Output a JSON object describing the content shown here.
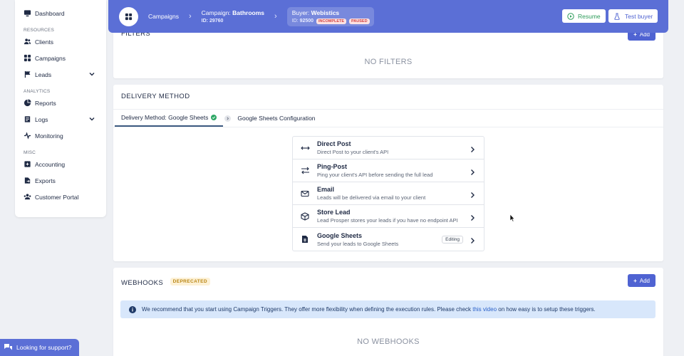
{
  "sidebar": {
    "items_top": [
      {
        "label": "Dashboard",
        "icon": "monitor-icon"
      }
    ],
    "sections": [
      {
        "title": "RESOURCES",
        "items": [
          {
            "label": "Clients",
            "icon": "users-icon"
          },
          {
            "label": "Campaigns",
            "icon": "grid-icon"
          },
          {
            "label": "Leads",
            "icon": "flag-icon"
          }
        ]
      },
      {
        "title": "ANALYTICS",
        "items": [
          {
            "label": "Reports",
            "icon": "pie-chart-icon"
          },
          {
            "label": "Logs",
            "icon": "log-icon"
          },
          {
            "label": "Monitoring",
            "icon": "heartbeat-icon"
          }
        ]
      },
      {
        "title": "MISC",
        "items": [
          {
            "label": "Accounting",
            "icon": "accounting-icon"
          },
          {
            "label": "Exports",
            "icon": "export-icon"
          },
          {
            "label": "Customer Portal",
            "icon": "portal-icon"
          }
        ]
      }
    ]
  },
  "topbar": {
    "crumb1": "Campaigns",
    "crumb2_prefix": "Campaign: ",
    "crumb2_name": "Bathrooms",
    "crumb2_id": "ID: 29760",
    "crumb3_prefix": "Buyer: ",
    "crumb3_name": "Webistics",
    "crumb3_id_label": "ID:",
    "crumb3_id": "92500",
    "badge_incomplete": "INCOMPLETE",
    "badge_paused": "PAUSED",
    "resume_label": "Resume",
    "test_buyer_label": "Test buyer"
  },
  "filters": {
    "title": "FILTERS",
    "add_label": "Add",
    "empty": "NO FILTERS"
  },
  "delivery": {
    "title": "DELIVERY METHOD",
    "tab_active": "Delivery Method: Google Sheets",
    "tab_next": "Google Sheets Configuration",
    "methods": [
      {
        "name": "Direct Post",
        "desc": "Direct Post to your client's API"
      },
      {
        "name": "Ping-Post",
        "desc": "Ping your client's API before sending the full lead"
      },
      {
        "name": "Email",
        "desc": "Leads will be delivered via email to your client"
      },
      {
        "name": "Store Lead",
        "desc": "Lead Prosper stores your leads if you have no endpoint API"
      },
      {
        "name": "Google Sheets",
        "desc": "Send your leads to Google Sheets",
        "badge": "Editing"
      }
    ]
  },
  "webhooks": {
    "title": "WEBHOOKS",
    "deprecated": "DEPRECATED",
    "add_label": "Add",
    "info_text": "We recommend that you start using Campaign Triggers. They offer more flexibility when defining the execution rules. Please check ",
    "info_link": "this video",
    "info_suffix": " on how easy is to setup these triggers.",
    "empty": "NO WEBHOOKS"
  },
  "support": {
    "label": "Looking for support?"
  },
  "colors": {
    "primary": "#5b6fd6",
    "button": "#4f63d2",
    "resume_green": "#2e9c5b",
    "check_green": "#2fa866"
  }
}
